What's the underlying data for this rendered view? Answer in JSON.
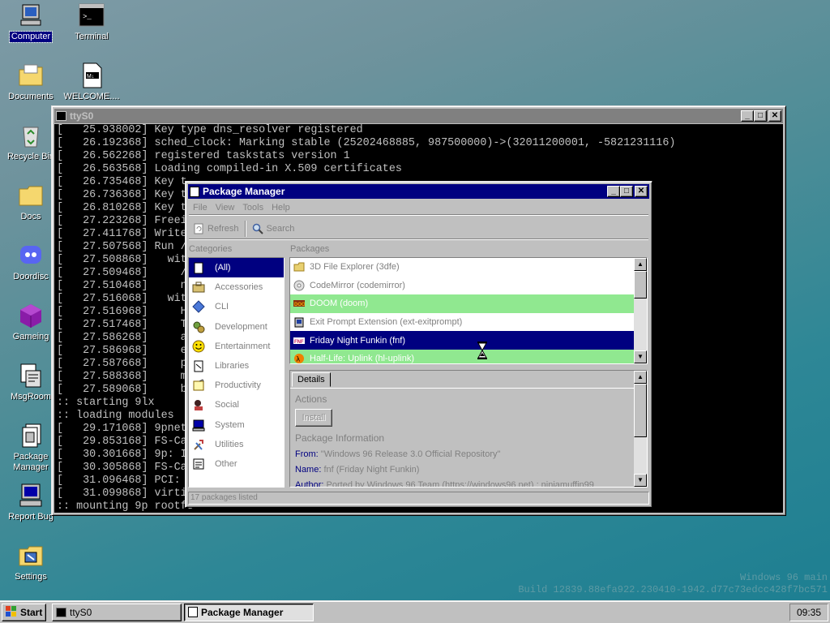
{
  "desktop": {
    "icons": [
      {
        "label": "Computer",
        "icon": "computer-icon",
        "selected": true
      },
      {
        "label": "Terminal",
        "icon": "terminal-icon"
      },
      {
        "label": "Documents",
        "icon": "folder-documents-icon"
      },
      {
        "label": "WELCOME....",
        "icon": "markdown-file-icon"
      },
      {
        "label": "Recycle Bin",
        "icon": "recycle-bin-icon"
      },
      {
        "label": "Docs",
        "icon": "folder-icon"
      },
      {
        "label": "Doordisc",
        "icon": "discord-icon"
      },
      {
        "label": "Gameing",
        "icon": "cube-icon"
      },
      {
        "label": "MsgRoom",
        "icon": "msgroom-icon"
      },
      {
        "label": "Package Manager",
        "icon": "package-manager-icon"
      },
      {
        "label": "Report Bug",
        "icon": "report-bug-icon"
      },
      {
        "label": "Settings",
        "icon": "settings-icon"
      }
    ],
    "watermark": {
      "line1": "Windows 96 main",
      "line2": "Build 12839.88efa922.230410-1942.d77c73edcc428f7bc571"
    }
  },
  "terminal": {
    "title": "ttyS0",
    "lines": [
      "[   25.938002] Key type dns_resolver registered",
      "[   26.192368] sched_clock: Marking stable (25202468885, 987500000)->(32011200001, -5821231116)",
      "[   26.562268] registered taskstats version 1",
      "[   26.563568] Loading compiled-in X.509 certificates",
      "[   26.735468] Key t",
      "[   26.736368] Key t",
      "[   26.810268] Key t",
      "[   27.223268] Freei",
      "[   27.411768] Write",
      "[   27.507568] Run /",
      "[   27.508868]   wit",
      "[   27.509468]     /",
      "[   27.510468]     n",
      "[   27.516068]   wit",
      "[   27.516968]     H",
      "[   27.517468]     T",
      "[   27.586268]     a",
      "[   27.586968]     e",
      "[   27.587668]     p",
      "[   27.588368]     m",
      "[   27.589068]     b",
      ":: starting 9lx",
      ":: loading modules",
      "[   29.171068] 9pnet",
      "[   29.853168] FS-Ca",
      "[   30.301668] 9p: I",
      "[   30.305868] FS-Ca",
      "[   31.096468] PCI: ",
      "[   31.099868] virti",
      ":: mounting 9p rootfs"
    ]
  },
  "pkgmgr": {
    "title": "Package Manager",
    "menu": [
      "File",
      "View",
      "Tools",
      "Help"
    ],
    "toolbar": {
      "refresh": "Refresh",
      "search": "Search"
    },
    "categories_label": "Categories",
    "packages_label": "Packages",
    "categories": [
      {
        "label": "(All)",
        "icon": "all-icon",
        "selected": true
      },
      {
        "label": "Accessories",
        "icon": "accessories-icon"
      },
      {
        "label": "CLI",
        "icon": "cli-diamond-icon"
      },
      {
        "label": "Development",
        "icon": "development-icon"
      },
      {
        "label": "Entertainment",
        "icon": "smiley-icon"
      },
      {
        "label": "Libraries",
        "icon": "libraries-icon"
      },
      {
        "label": "Productivity",
        "icon": "productivity-icon"
      },
      {
        "label": "Social",
        "icon": "social-icon"
      },
      {
        "label": "System",
        "icon": "system-icon"
      },
      {
        "label": "Utilities",
        "icon": "utilities-icon"
      },
      {
        "label": "Other",
        "icon": "other-icon"
      }
    ],
    "packages": [
      {
        "label": "3D File Explorer (3dfe)",
        "state": "normal",
        "icon": "folder-icon"
      },
      {
        "label": "CodeMirror (codemirror)",
        "state": "normal",
        "icon": "disc-icon"
      },
      {
        "label": "DOOM (doom)",
        "state": "installed",
        "icon": "doom-icon"
      },
      {
        "label": "Exit Prompt Extension (ext-exitprompt)",
        "state": "normal",
        "icon": "extension-icon"
      },
      {
        "label": "Friday Night Funkin (fnf)",
        "state": "selected",
        "icon": "fnf-icon"
      },
      {
        "label": "Half-Life: Uplink (hl-uplink)",
        "state": "installed",
        "icon": "halflife-icon"
      }
    ],
    "details": {
      "tab": "Details",
      "actions_heading": "Actions",
      "install_button": "Install",
      "info_heading": "Package Information",
      "from_label": "From:",
      "from_value": "\"Windows 96 Release 3.0 Official Repository\"",
      "name_label": "Name:",
      "name_value": "fnf (Friday Night Funkin)",
      "author_label": "Author:",
      "author_value": "Ported by Windows 96 Team (https://windows96.net) ; ninjamuffin99"
    },
    "status": "17 packages listed"
  },
  "taskbar": {
    "start": "Start",
    "tasks": [
      {
        "label": "ttyS0",
        "active": false
      },
      {
        "label": "Package Manager",
        "active": true
      }
    ],
    "clock": "09:35"
  },
  "colors": {
    "selection": "#000080",
    "installed": "#90e890",
    "window": "#c0c0c0"
  }
}
